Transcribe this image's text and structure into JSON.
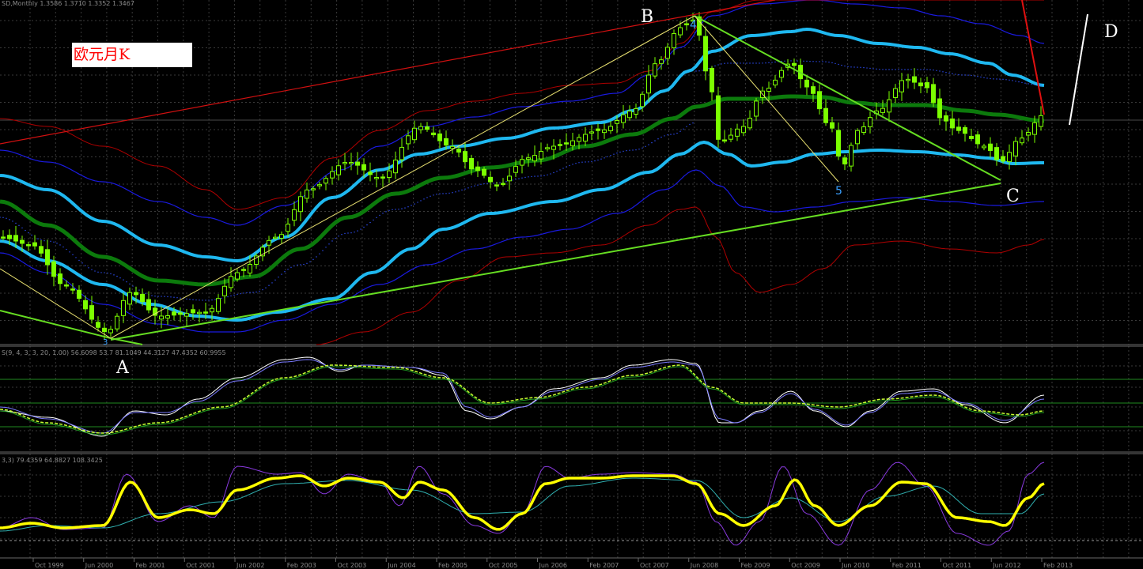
{
  "header": {
    "symbol_line": "SD,Monthly  1.3586 1.3710 1.3352 1.3467",
    "osc1_line": "S(9, 4, 3, 3, 20, 1.00) 56.6098 53.7 81.1049 44.3127 47.4352 60.9955",
    "osc2_line": "3,3) 79.4359 64.8827 108.3425"
  },
  "title_box": {
    "text": "欧元月K"
  },
  "wave_labels": {
    "A": "A",
    "B": "B",
    "C": "C",
    "D": "D",
    "w4": "4",
    "w5": "5",
    "w3": "3"
  },
  "colors": {
    "background": "#000000",
    "grid": "#3a3a3a",
    "candle": "#7cff00",
    "bb_inner": "#1fb8f0",
    "bb_outer": "#1a1ae0",
    "bb_mid": "#0c7a0c",
    "env_outer": "#b00000",
    "trendline": "#66dd22",
    "fib": "#e8e070",
    "osc_main": "#ffff00"
  },
  "chart_data": [
    {
      "type": "candlestick",
      "title": "",
      "xlabel": "",
      "ylabel": "",
      "x": [
        "Oct 1999",
        "Jun 2000",
        "Feb 2001",
        "Oct 2001",
        "Jun 2002",
        "Feb 2003",
        "Oct 2003",
        "Jun 2004",
        "Feb 2005",
        "Oct 2005",
        "Jun 2006",
        "Feb 2007",
        "Oct 2007",
        "Jun 2008",
        "Feb 2009",
        "Oct 2009",
        "Jun 2010",
        "Feb 2011",
        "Oct 2011",
        "Jun 2012",
        "Feb 2013"
      ],
      "x_ticks": [
        "Oct 1999",
        "Jun 2000",
        "Feb 2001",
        "Oct 2001",
        "Jun 2002",
        "Feb 2003",
        "Oct 2003",
        "Jun 2004",
        "Feb 2005",
        "Oct 2005",
        "Jun 2006",
        "Feb 2007",
        "Oct 2007",
        "Jun 2008",
        "Feb 2009",
        "Oct 2009",
        "Jun 2010",
        "Feb 2011",
        "Oct 2011",
        "Jun 2012",
        "Feb 2013"
      ],
      "close": [
        1.05,
        0.87,
        0.92,
        0.88,
        0.98,
        1.07,
        1.16,
        1.22,
        1.32,
        1.19,
        1.26,
        1.31,
        1.41,
        1.58,
        1.29,
        1.48,
        1.22,
        1.36,
        1.39,
        1.24,
        1.35
      ],
      "ylim": [
        0.82,
        1.62
      ],
      "grid": true
    },
    {
      "type": "line",
      "title": "",
      "series": [
        {
          "name": "",
          "values": [
            30,
            18,
            26,
            32,
            52,
            74,
            80,
            70,
            72,
            48,
            50,
            60,
            70,
            85,
            20,
            45,
            15,
            35,
            40,
            18,
            40
          ]
        },
        {
          "name": "",
          "values": [
            28,
            20,
            24,
            30,
            48,
            70,
            78,
            70,
            70,
            50,
            50,
            58,
            68,
            82,
            24,
            44,
            18,
            34,
            38,
            20,
            36
          ]
        }
      ],
      "ylim": [
        0,
        100
      ],
      "grid": true
    },
    {
      "type": "line",
      "title": "",
      "series": [
        {
          "name": "",
          "values": [
            20,
            12,
            30,
            25,
            60,
            88,
            92,
            70,
            80,
            30,
            55,
            70,
            72,
            86,
            10,
            70,
            0,
            60,
            45,
            10,
            85
          ]
        },
        {
          "name": "",
          "values": [
            22,
            14,
            28,
            24,
            55,
            82,
            90,
            72,
            76,
            34,
            52,
            68,
            70,
            82,
            14,
            66,
            5,
            58,
            44,
            12,
            75
          ]
        }
      ],
      "ylim": [
        -10,
        110
      ],
      "grid": true
    }
  ]
}
